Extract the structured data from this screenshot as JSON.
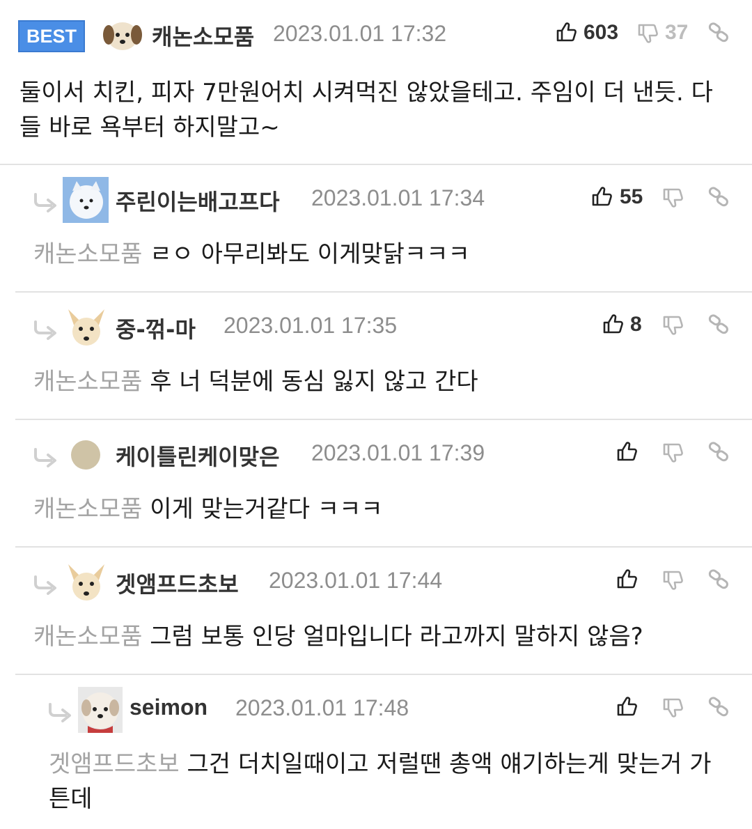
{
  "best_comment": {
    "badge": "BEST",
    "nickname": "캐논소모품",
    "date": "2023.01.01 17:32",
    "likes": "603",
    "dislikes": "37",
    "text_line1": "둘이서 치킨, 피자 7만원어치 시켜먹진 않았을테고. 주임이 더 낸듯. 다",
    "text_line2": "들 바로 욕부터 하지말고~"
  },
  "replies": [
    {
      "nickname": "주린이는배고프다",
      "date": "2023.01.01 17:34",
      "likes": "55",
      "quote": "캐논소모품",
      "text": "ㄹㅇ 아무리봐도 이게맞닭ㅋㅋㅋ",
      "avatar": "white-dog-avatar"
    },
    {
      "nickname": "중-꺾-마",
      "date": "2023.01.01 17:35",
      "likes": "8",
      "quote": "캐논소모품",
      "text": "후 너 덕분에 동심 잃지 않고 간다",
      "avatar": "chihuahua-avatar"
    },
    {
      "nickname": "케이틀린케이맞은",
      "date": "2023.01.01 17:39",
      "likes": "",
      "quote": "캐논소모품",
      "text": "이게 맞는거같다 ㅋㅋㅋ",
      "avatar": "beige-circle-avatar"
    },
    {
      "nickname": "겟앰프드초보",
      "date": "2023.01.01 17:44",
      "likes": "",
      "quote": "캐논소모품",
      "text": "그럼 보통 인당 얼마입니다 라고까지 말하지 않음?",
      "avatar": "chihuahua-avatar"
    },
    {
      "nickname": "seimon",
      "date": "2023.01.01 17:48",
      "likes": "",
      "quote": "겟앰프드초보",
      "text_line1": "그건 더치일때이고 저럴땐 총액 얘기하는게 맞는거 가",
      "text_line2": "튼데",
      "avatar": "red-dog-avatar"
    }
  ],
  "icons": {
    "like": "thumbs-up-icon",
    "dislike": "thumbs-down-icon",
    "link": "link-icon",
    "reply": "reply-arrow-icon"
  },
  "colors": {
    "badge": "#4a8ee6",
    "date": "#8d8d8d",
    "quote": "#a3a3a3"
  }
}
